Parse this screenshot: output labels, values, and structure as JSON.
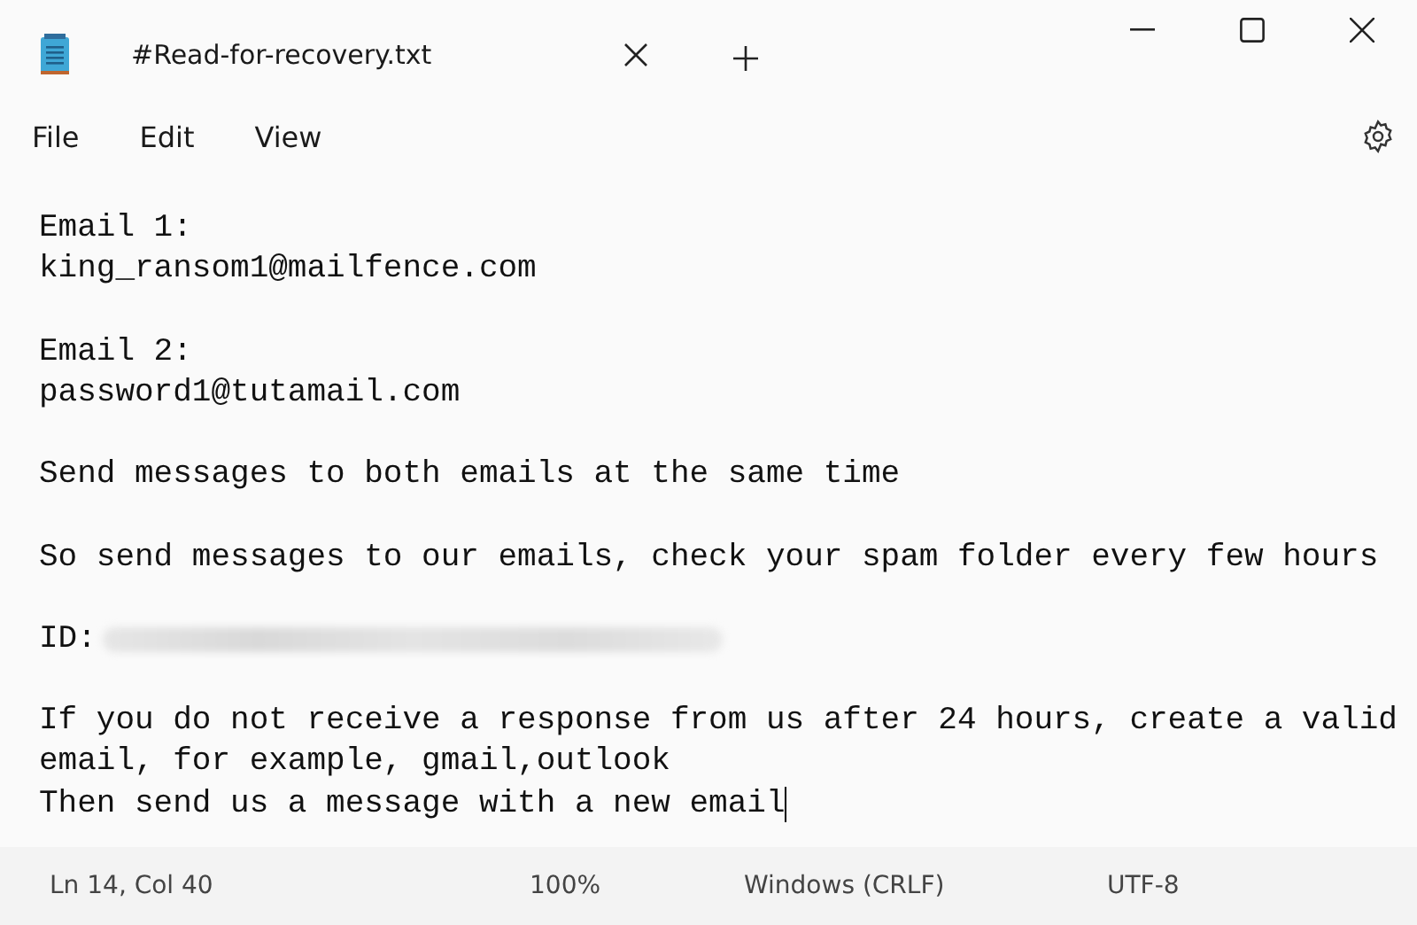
{
  "tab": {
    "title": "#Read-for-recovery.txt",
    "selected": true
  },
  "menu": [
    "File",
    "Edit",
    "View"
  ],
  "lines": [
    {
      "kind": "text",
      "text": "Email 1:"
    },
    {
      "kind": "text",
      "text": "king_ransom1@mailfence.com"
    },
    {
      "kind": "blank"
    },
    {
      "kind": "text",
      "text": "Email 2:"
    },
    {
      "kind": "text",
      "text": "password1@tutamail.com"
    },
    {
      "kind": "blank"
    },
    {
      "kind": "text",
      "text": "Send messages to both emails at the same time"
    },
    {
      "kind": "blank"
    },
    {
      "kind": "text",
      "text": "So send messages to our emails, check your spam folder every few hours"
    },
    {
      "kind": "blank"
    },
    {
      "kind": "redacted",
      "text": "ID:"
    },
    {
      "kind": "blank"
    },
    {
      "kind": "text",
      "text": "If you do not receive a response from us after 24 hours, create a valid"
    },
    {
      "kind": "text",
      "text": "email, for example, gmail,outlook"
    },
    {
      "kind": "text",
      "text": "Then send us a message with a new email",
      "caret": true
    }
  ],
  "status_bar": {
    "position": "Ln 14, Col 40",
    "zoom": "100%",
    "line_endings": "Windows (CRLF)",
    "encoding": "UTF-8"
  }
}
